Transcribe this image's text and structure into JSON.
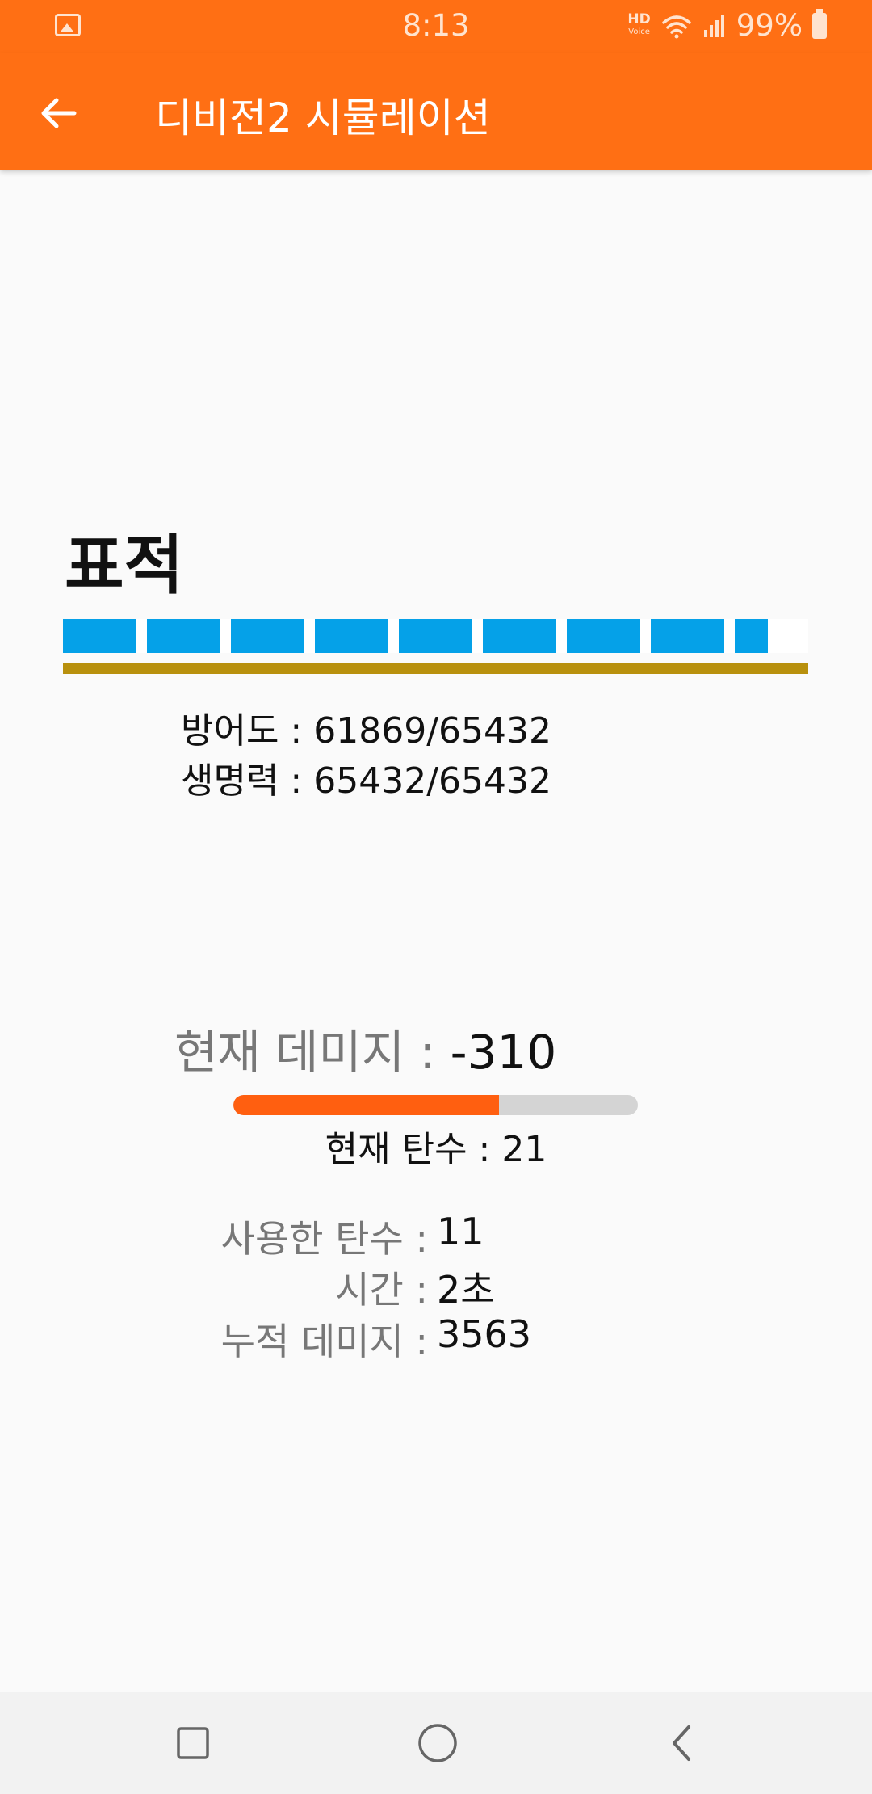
{
  "status_bar": {
    "time": "8:13",
    "hd_label": "HD",
    "voice_label": "Voice",
    "battery": "99%",
    "icons": [
      "gallery-icon",
      "wifi-icon",
      "signal-icon",
      "battery-icon"
    ]
  },
  "app_bar": {
    "title": "디비전2 시뮬레이션",
    "back_icon": "arrow-back-icon",
    "color": "#ff6f14"
  },
  "target": {
    "title": "표적",
    "armor_label": "방어도 : 61869/65432",
    "health_label": "생명력 : 65432/65432",
    "armor_fraction": 0.9455,
    "health_fraction": 1.0,
    "armor_color": "#05a1e8",
    "health_color": "#b8900d"
  },
  "damage": {
    "label": "현재 데미지 : ",
    "value": "-310"
  },
  "ammo": {
    "label": "현재 탄수 : 21",
    "fill_fraction": 0.656,
    "fill_color": "#ff5f10"
  },
  "stats": {
    "used_label": "사용한 탄수 :",
    "used_value": "11",
    "time_label": "시간 :",
    "time_value": "2초",
    "total_label": "누적 데미지 :",
    "total_value": "3563"
  },
  "nav_bar": {
    "icons": [
      "recent-apps-icon",
      "home-icon",
      "back-icon"
    ]
  }
}
